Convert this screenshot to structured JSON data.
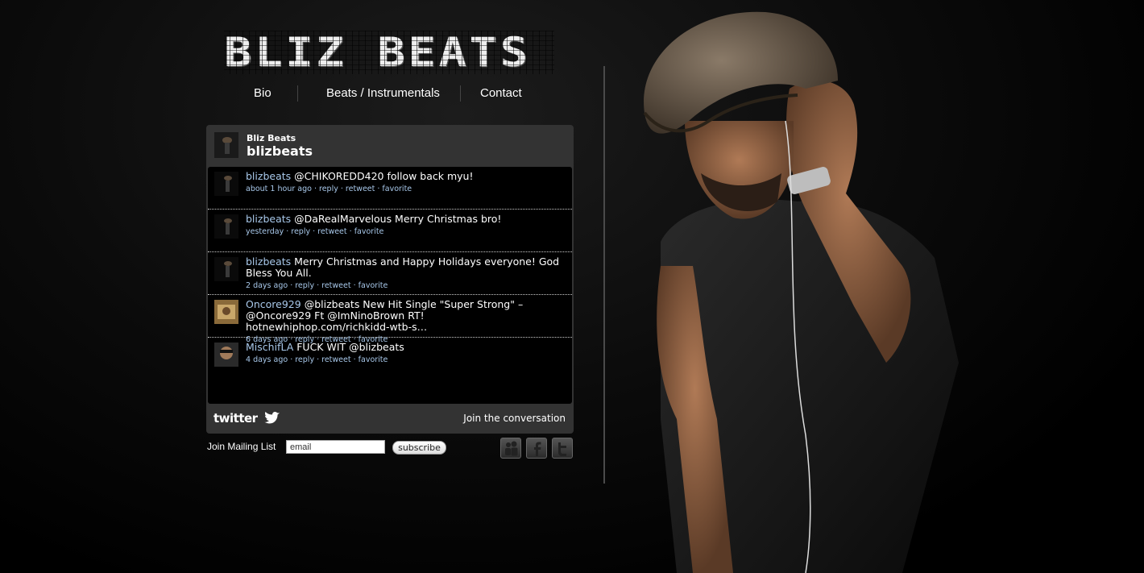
{
  "site": {
    "logo_text": "BLIZ BEATS"
  },
  "nav": {
    "items": [
      {
        "label": "Bio"
      },
      {
        "label": "Beats / Instrumentals"
      },
      {
        "label": "Contact"
      }
    ]
  },
  "widget": {
    "display_name": "Bliz Beats",
    "screen_name": "blizbeats",
    "tweets": [
      {
        "user": "blizbeats",
        "text": "@CHIKOREDD420 follow back myu!",
        "time": "about 1 hour ago"
      },
      {
        "user": "blizbeats",
        "text": "@DaRealMarvelous Merry Christmas bro!",
        "time": "yesterday"
      },
      {
        "user": "blizbeats",
        "text": "Merry Christmas and Happy Holidays everyone! God Bless You All.",
        "time": "2 days ago"
      },
      {
        "user": "Oncore929",
        "text": "@blizbeats New Hit Single \"Super Strong\" – @Oncore929 Ft @ImNinoBrown RT! hotnewhiphop.com/richkidd-wtb-s…",
        "time": "6 days ago"
      },
      {
        "user": "MischifLA",
        "text": "FUCK WIT @blizbeats",
        "time": "4 days ago"
      }
    ],
    "actions": {
      "reply": "reply",
      "retweet": "retweet",
      "favorite": "favorite"
    },
    "footer": {
      "logo": "twitter",
      "join": "Join the conversation"
    }
  },
  "mailing": {
    "label": "Join Mailing List",
    "email_value": "email",
    "subscribe_label": "subscribe"
  },
  "social": [
    {
      "icon": "myspace-icon"
    },
    {
      "icon": "facebook-icon"
    },
    {
      "icon": "twitter-icon"
    }
  ],
  "colors": {
    "link": "#a8c8ea",
    "widget_bg": "#333333",
    "tweet_bg": "#000000"
  }
}
